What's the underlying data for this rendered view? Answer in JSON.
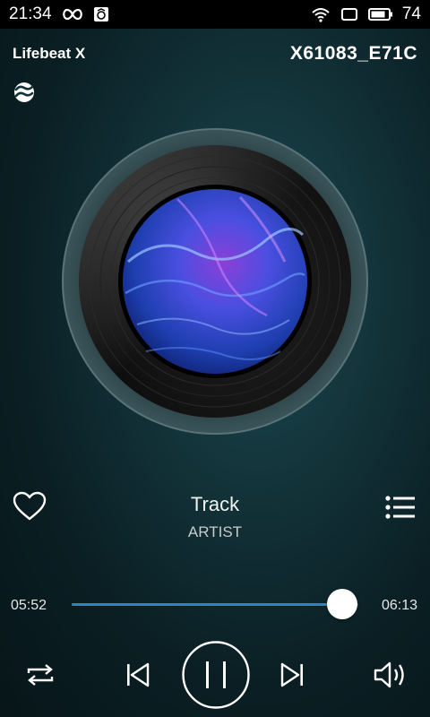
{
  "status_bar": {
    "time": "21:34",
    "battery": "74",
    "icons": [
      "infinity-icon",
      "app-notification-icon",
      "wifi-icon",
      "screen-icon",
      "battery-icon"
    ]
  },
  "header": {
    "app_name": "Lifebeat X",
    "device_id": "X61083_E71C",
    "link_icon": "link-icon"
  },
  "player": {
    "track": "Track",
    "artist": "ARTIST",
    "elapsed": "05:52",
    "duration": "06:13",
    "progress_fraction": 0.943
  },
  "controls": {
    "icons": [
      "repeat-icon",
      "previous-icon",
      "pause-icon",
      "next-icon",
      "volume-icon"
    ],
    "favorite_icon": "heart-icon",
    "playlist_icon": "playlist-icon"
  },
  "colors": {
    "accent": "#2f84c4",
    "background": "#123238"
  }
}
